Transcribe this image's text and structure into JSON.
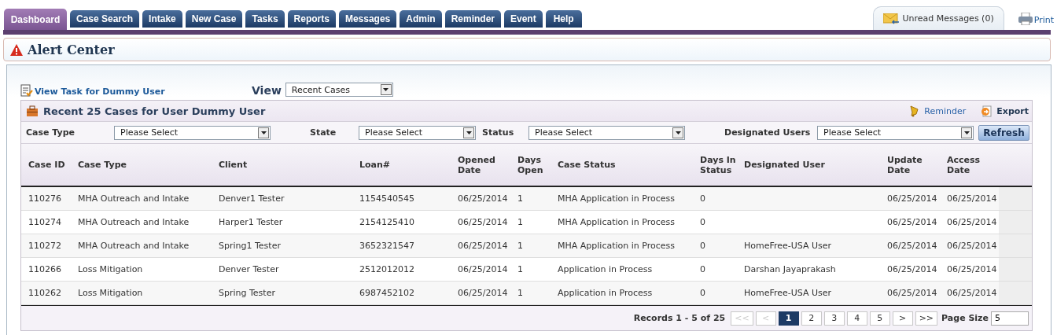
{
  "tabs": [
    {
      "label": "Dashboard",
      "selected": true
    },
    {
      "label": "Case Search",
      "selected": false
    },
    {
      "label": "Intake",
      "selected": false
    },
    {
      "label": "New Case",
      "selected": false
    },
    {
      "label": "Tasks",
      "selected": false
    },
    {
      "label": "Reports",
      "selected": false
    },
    {
      "label": "Messages",
      "selected": false
    },
    {
      "label": "Admin",
      "selected": false
    },
    {
      "label": "Reminder",
      "selected": false
    },
    {
      "label": "Event",
      "selected": false
    },
    {
      "label": "Help",
      "selected": false
    }
  ],
  "unread_messages": "Unread Messages (0)",
  "print": "Print",
  "alert_center": "Alert Center",
  "task_link": "View Task for Dummy User",
  "view": {
    "label": "View",
    "value": "Recent Cases"
  },
  "panel": {
    "title": "Recent 25 Cases for User Dummy User",
    "actions": [
      {
        "label": "Reminder",
        "kind": "reminder"
      },
      {
        "label": "Export",
        "kind": "export"
      }
    ]
  },
  "filters": [
    {
      "label": "Case Type",
      "value": "Please Select"
    },
    {
      "label": "State",
      "value": "Please Select"
    },
    {
      "label": "Status",
      "value": "Please Select"
    },
    {
      "label": "Designated Users",
      "value": "Please Select"
    }
  ],
  "refresh": "Refresh",
  "table": {
    "columns": [
      "Case ID",
      "Case Type",
      "Client",
      "Loan#",
      "Opened Date",
      "Days Open",
      "Case Status",
      "Days In Status",
      "Designated User",
      "Update Date",
      "Access Date"
    ],
    "rows": [
      [
        "110276",
        "MHA Outreach and Intake",
        "Denver1 Tester",
        "1154540545",
        "06/25/2014",
        "1",
        "MHA Application in Process",
        "0",
        "",
        "06/25/2014",
        "06/25/2014"
      ],
      [
        "110274",
        "MHA Outreach and Intake",
        "Harper1 Tester",
        "2154125410",
        "06/25/2014",
        "1",
        "MHA Application in Process",
        "0",
        "",
        "06/25/2014",
        "06/25/2014"
      ],
      [
        "110272",
        "MHA Outreach and Intake",
        "Spring1 Tester",
        "3652321547",
        "06/25/2014",
        "1",
        "MHA Application in Process",
        "0",
        "HomeFree-USA User",
        "06/25/2014",
        "06/25/2014"
      ],
      [
        "110266",
        "Loss Mitigation",
        "Denver Tester",
        "2512012012",
        "06/25/2014",
        "1",
        "Application in Process",
        "0",
        "Darshan Jayaprakash",
        "06/25/2014",
        "06/25/2014"
      ],
      [
        "110262",
        "Loss Mitigation",
        "Spring Tester",
        "6987452102",
        "06/25/2014",
        "1",
        "Application in Process",
        "0",
        "HomeFree-USA User",
        "06/25/2014",
        "06/25/2014"
      ]
    ]
  },
  "pagination": {
    "summary": "Records 1 - 5 of 25",
    "pages": [
      {
        "label": "<<",
        "selected": false,
        "disabled": true
      },
      {
        "label": "<",
        "selected": false,
        "disabled": true
      },
      {
        "label": "1",
        "selected": true,
        "disabled": false
      },
      {
        "label": "2",
        "selected": false,
        "disabled": false
      },
      {
        "label": "3",
        "selected": false,
        "disabled": false
      },
      {
        "label": "4",
        "selected": false,
        "disabled": false
      },
      {
        "label": "5",
        "selected": false,
        "disabled": false
      },
      {
        "label": ">",
        "selected": false,
        "disabled": false
      },
      {
        "label": ">>",
        "selected": false,
        "disabled": false
      }
    ],
    "page_size_label": "Page Size",
    "page_size": "5"
  }
}
